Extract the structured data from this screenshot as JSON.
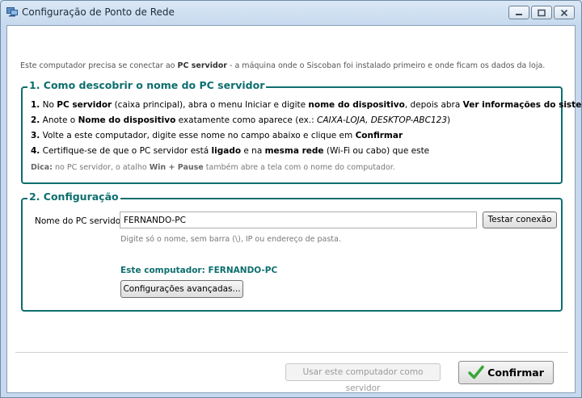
{
  "window": {
    "title": "Configuração de Ponto de Rede"
  },
  "intro": {
    "before": "Este computador precisa se conectar ao ",
    "bold": "PC servidor",
    "after": " - a máquina onde o Siscoban foi instalado primeiro e onde ficam os dados da loja."
  },
  "section1": {
    "title": "1. Como descobrir o nome do PC servidor",
    "step1": {
      "num": "1.",
      "t1": " No ",
      "b1": "PC servidor",
      "t2": " (caixa principal), abra o menu Iniciar e digite ",
      "b2": "nome do dispositivo",
      "t3": ", depois abra ",
      "b3": "Ver informações do sistema"
    },
    "step2": {
      "num": "2.",
      "t1": " Anote o ",
      "b1": "Nome do dispositivo",
      "t2": " exatamente como aparece (ex.: ",
      "i1": "CAIXA-LOJA, DESKTOP-ABC123",
      "t3": ")"
    },
    "step3": {
      "num": "3.",
      "t1": " Volte a este computador, digite esse nome no campo abaixo e clique em ",
      "b1": "Confirmar"
    },
    "step4": {
      "num": "4.",
      "t1": " Certifique-se de que o PC servidor está ",
      "b1": "ligado",
      "t2": " e na ",
      "b2": "mesma rede",
      "t3": " (Wi-Fi ou cabo) que este"
    },
    "hint": {
      "label": "Dica:",
      "t1": " no PC servidor, o atalho ",
      "b1": "Win + Pause",
      "t2": " também abre a tela com o nome do computador."
    }
  },
  "section2": {
    "title": "2. Configuração",
    "server_label": "Nome do PC servidor:",
    "server_value": "FERNANDO-PC",
    "test_button": "Testar conexão",
    "field_hint": "Digite só o nome, sem barra (\\), IP ou endereço de pasta.",
    "this_computer": "Este computador: FERNANDO-PC",
    "advanced_button": "Configurações avançadas..."
  },
  "footer": {
    "use_as_server_button": "Usar este computador como servidor",
    "confirm_button": "Confirmar"
  },
  "colors": {
    "accent": "#0e6e6e",
    "confirm_check": "#3aa537"
  },
  "icons": {
    "app": "network-app-icon",
    "confirm": "checkmark-icon"
  }
}
